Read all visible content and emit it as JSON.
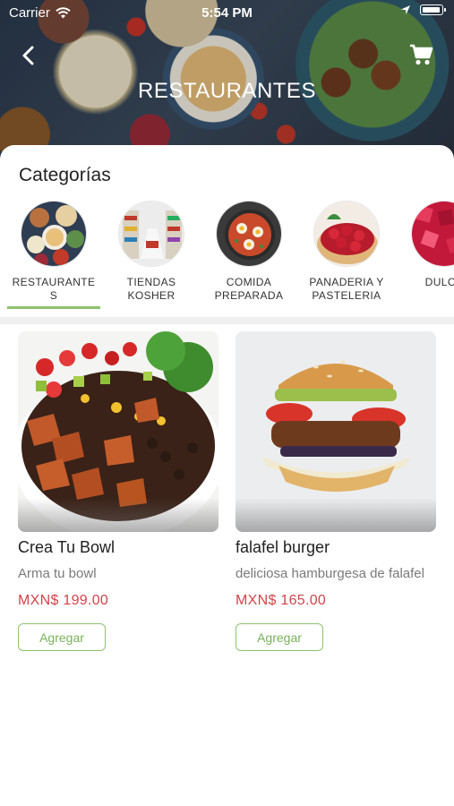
{
  "status_bar": {
    "carrier": "Carrier",
    "time": "5:54 PM"
  },
  "header": {
    "title": "RESTAURANTES",
    "back_icon": "chevron-left-icon",
    "cart_icon": "shopping-cart-icon"
  },
  "categories": {
    "heading": "Categorías",
    "items": [
      {
        "label": "RESTAURANTE\nS",
        "selected": true
      },
      {
        "label": "TIENDAS\nKOSHER",
        "selected": false
      },
      {
        "label": "COMIDA\nPREPARADA",
        "selected": false
      },
      {
        "label": "PANADERIA Y\nPASTELERIA",
        "selected": false
      },
      {
        "label": "DULCE",
        "selected": false
      }
    ]
  },
  "products": [
    {
      "name": "Crea Tu Bowl",
      "description": "Arma tu bowl",
      "price": "MXN$ 199.00",
      "button": "Agregar"
    },
    {
      "name": "falafel burger",
      "description": "deliciosa hamburgesa de falafel",
      "price": "MXN$ 165.00",
      "button": "Agregar"
    }
  ],
  "colors": {
    "accent_green": "#8dc26f",
    "price_red": "#d2444a"
  }
}
